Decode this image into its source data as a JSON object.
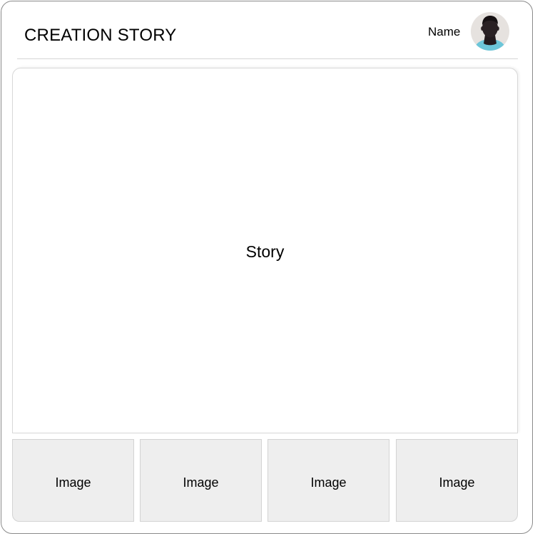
{
  "header": {
    "title": "CREATION STORY",
    "user_name": "Name",
    "avatar_icon": "user-avatar-icon"
  },
  "main": {
    "story_label": "Story"
  },
  "images": [
    {
      "label": "Image"
    },
    {
      "label": "Image"
    },
    {
      "label": "Image"
    },
    {
      "label": "Image"
    }
  ],
  "colors": {
    "frame_border": "#8a8a8a",
    "divider": "#d5d5d5",
    "tile_background": "#eeeeee",
    "avatar_background": "#e6e2df",
    "avatar_shirt": "#6cc6d9",
    "avatar_skin": "#2a2124"
  }
}
